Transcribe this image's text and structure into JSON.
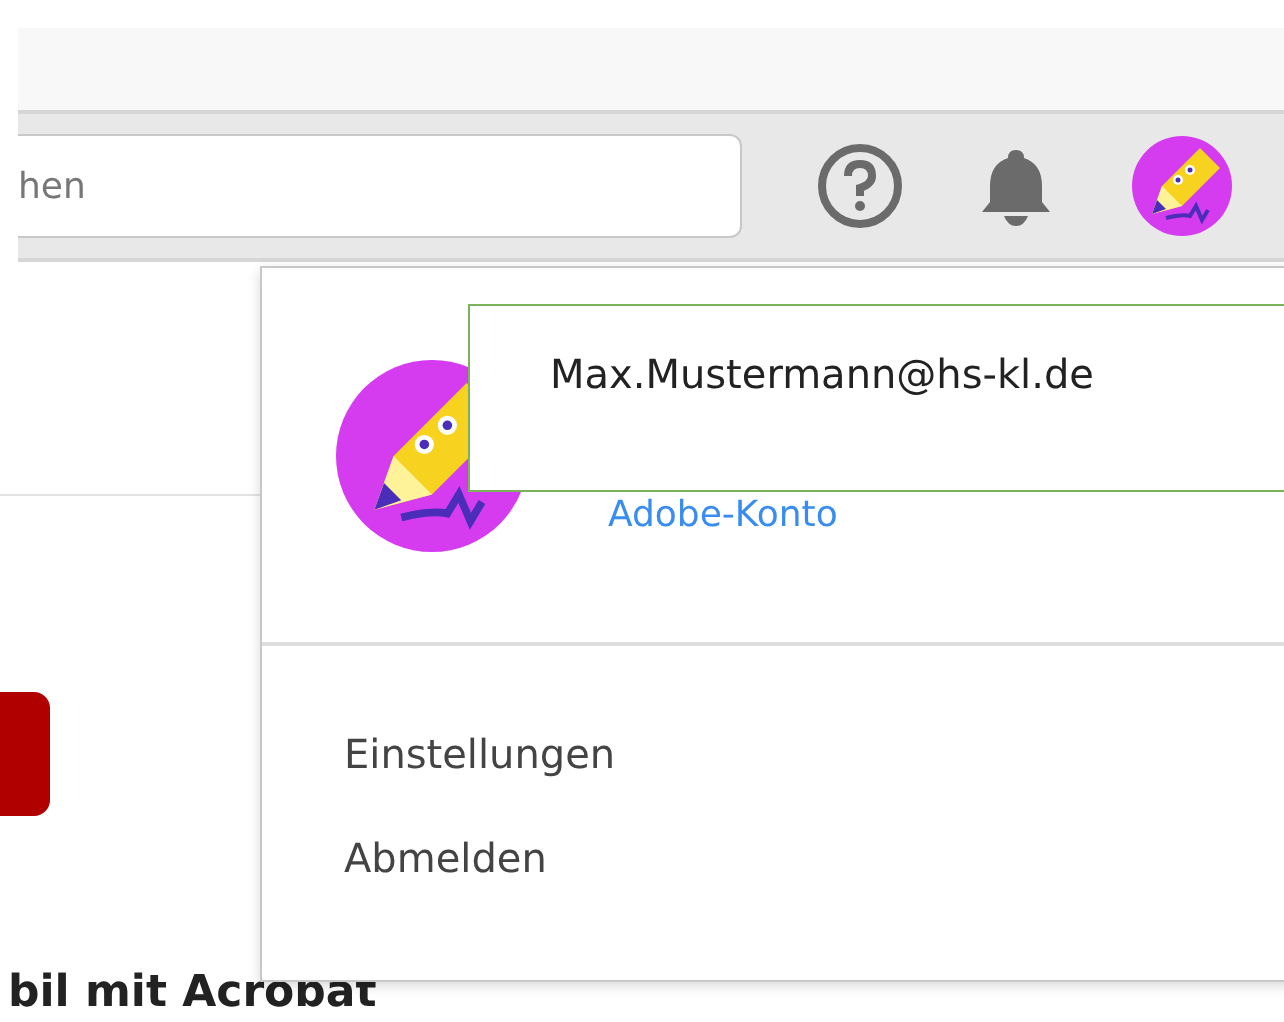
{
  "search": {
    "placeholder": "hen"
  },
  "profile_menu": {
    "email": "Max.Mustermann@hs-kl.de",
    "account_link": "Adobe-Konto",
    "items": [
      {
        "label": "Einstellungen"
      },
      {
        "label": "Abmelden"
      }
    ]
  },
  "page": {
    "heading": "bil mit Acrobat"
  }
}
